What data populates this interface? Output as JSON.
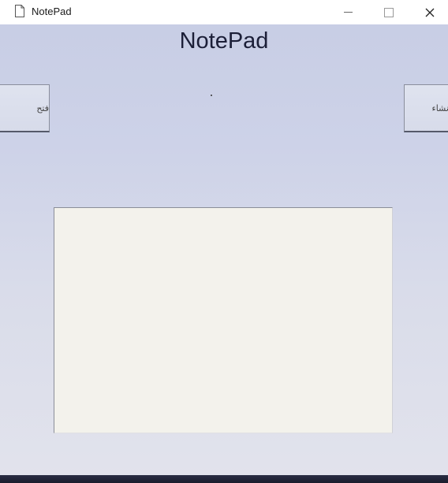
{
  "window": {
    "title": "NotePad",
    "icon": "document-icon",
    "controls": {
      "minimize": "minimize-icon",
      "maximize": "maximize-icon",
      "close": "✕"
    }
  },
  "main": {
    "heading": "NotePad",
    "open_button": "فتح",
    "create_button": "انشاء",
    "editor": {
      "value": "",
      "placeholder": ""
    }
  }
}
